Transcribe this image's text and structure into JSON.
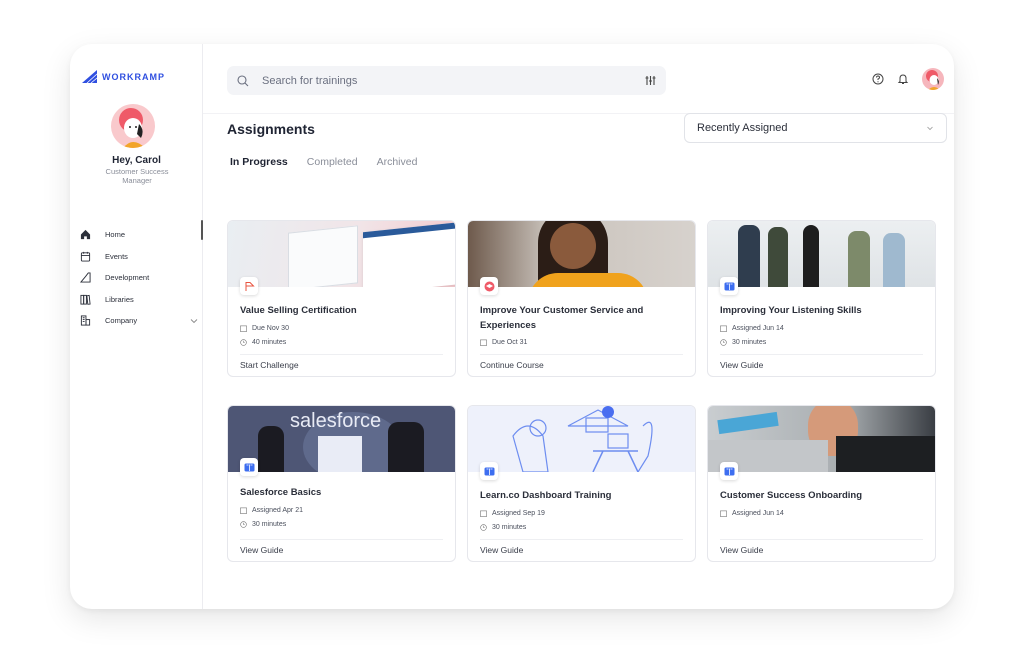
{
  "brand": {
    "name": "WORKRAMP",
    "color": "#2f4fe0"
  },
  "user": {
    "greeting": "Hey, Carol",
    "role": "Customer Success Manager"
  },
  "sidebar": {
    "items": [
      {
        "label": "Home",
        "icon": "home-icon",
        "active": true
      },
      {
        "label": "Events",
        "icon": "calendar-icon"
      },
      {
        "label": "Development",
        "icon": "development-icon"
      },
      {
        "label": "Libraries",
        "icon": "library-icon"
      },
      {
        "label": "Company",
        "icon": "building-icon",
        "expandable": true
      }
    ]
  },
  "search": {
    "placeholder": "Search for trainings"
  },
  "header": {
    "icons": [
      "help-icon",
      "bell-icon",
      "avatar"
    ]
  },
  "page": {
    "title": "Assignments",
    "sort": {
      "selected": "Recently Assigned"
    },
    "tabs": [
      {
        "label": "In Progress",
        "active": true
      },
      {
        "label": "Completed"
      },
      {
        "label": "Archived"
      }
    ]
  },
  "cards": [
    {
      "title": "Value Selling Certification",
      "type": "challenge",
      "date": "Due Nov 30",
      "duration": "40 minutes",
      "action": "Start Challenge"
    },
    {
      "title": "Improve Your Customer Service and Experiences",
      "type": "course",
      "date": "Due Oct 31",
      "duration": "",
      "action": "Continue Course"
    },
    {
      "title": "Improving Your Listening Skills",
      "type": "guide",
      "date": "Assigned Jun 14",
      "duration": "30 minutes",
      "action": "View Guide"
    },
    {
      "title": "Salesforce Basics",
      "type": "guide",
      "date": "Assigned Apr 21",
      "duration": "30 minutes",
      "action": "View Guide",
      "thumb_text": "salesforce"
    },
    {
      "title": "Learn.co Dashboard Training",
      "type": "guide",
      "date": "Assigned Sep 19",
      "duration": "30 minutes",
      "action": "View Guide"
    },
    {
      "title": "Customer Success Onboarding",
      "type": "guide",
      "date": "Assigned Jun 14",
      "duration": "",
      "action": "View Guide"
    }
  ]
}
